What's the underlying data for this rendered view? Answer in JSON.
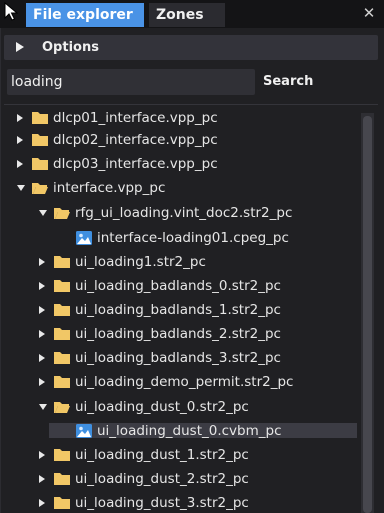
{
  "tabs": [
    {
      "label": "File explorer",
      "active": true
    },
    {
      "label": "Zones",
      "active": false
    }
  ],
  "close_icon": "close-icon",
  "options": {
    "label": "Options",
    "icon": "expand-triangle-icon"
  },
  "search": {
    "value": "loading",
    "button_label": "Search"
  },
  "tree": [
    {
      "label": "dlcp01_interface.vpp_pc",
      "type": "folder",
      "expanded": false
    },
    {
      "label": "dlcp02_interface.vpp_pc",
      "type": "folder",
      "expanded": false
    },
    {
      "label": "dlcp03_interface.vpp_pc",
      "type": "folder",
      "expanded": false
    },
    {
      "label": "interface.vpp_pc",
      "type": "folder",
      "expanded": true
    },
    {
      "label": "rfg_ui_loading.vint_doc2.str2_pc",
      "type": "folder",
      "expanded": true
    },
    {
      "label": "interface-loading01.cpeg_pc",
      "type": "image",
      "expanded": false
    },
    {
      "label": "ui_loading1.str2_pc",
      "type": "folder",
      "expanded": false
    },
    {
      "label": "ui_loading_badlands_0.str2_pc",
      "type": "folder",
      "expanded": false
    },
    {
      "label": "ui_loading_badlands_1.str2_pc",
      "type": "folder",
      "expanded": false
    },
    {
      "label": "ui_loading_badlands_2.str2_pc",
      "type": "folder",
      "expanded": false
    },
    {
      "label": "ui_loading_badlands_3.str2_pc",
      "type": "folder",
      "expanded": false
    },
    {
      "label": "ui_loading_demo_permit.str2_pc",
      "type": "folder",
      "expanded": false
    },
    {
      "label": "ui_loading_dust_0.str2_pc",
      "type": "folder",
      "expanded": true
    },
    {
      "label": "ui_loading_dust_0.cvbm_pc",
      "type": "image",
      "expanded": false,
      "selected": true
    },
    {
      "label": "ui_loading_dust_1.str2_pc",
      "type": "folder",
      "expanded": false
    },
    {
      "label": "ui_loading_dust_2.str2_pc",
      "type": "folder",
      "expanded": false
    },
    {
      "label": "ui_loading_dust_3.str2_pc",
      "type": "folder",
      "expanded": false
    }
  ],
  "colors": {
    "accent": "#4a93e6",
    "folder": "#f1c766",
    "image_icon": "#3f8fe0",
    "background": "#202023"
  }
}
